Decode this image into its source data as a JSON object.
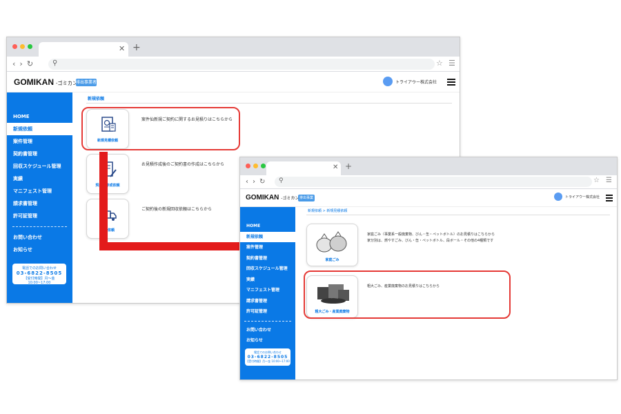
{
  "browser": {
    "url_icon": "search-icon"
  },
  "app": {
    "logo": "GOMIKAN",
    "logo_sub": "-ゴミカン-",
    "badge": "排出事業者",
    "company": "トライアウー株式会社"
  },
  "sidebar": {
    "items": [
      "HOME",
      "新規依頼",
      "案件管理",
      "契約書管理",
      "回収スケジュール管理",
      "実績",
      "マニフェスト管理",
      "請求書管理",
      "許可証管理"
    ],
    "items2": [
      "お問い合わせ",
      "お知らせ"
    ],
    "phone_title": "電話でのお問い合わせ",
    "phone_number": "03-6822-8505",
    "phone_hours": "【受付時間】月～金 10:00~17:00"
  },
  "back_window": {
    "page_title": "新規依頼",
    "cards": [
      {
        "label": "新規見積依頼",
        "desc": "案件仙新規ご契約に関するお見積りはこちらから"
      },
      {
        "label": "契約書作成依頼",
        "desc": "お見積作成後のご契約書の作成はこちらから"
      },
      {
        "label": "回収依頼",
        "desc": "ご契約後の新規回収依頼はこちらから"
      }
    ]
  },
  "front_window": {
    "breadcrumb": "新規依頼 > 新規見積依頼",
    "cards": [
      {
        "label": "家庭ごみ",
        "desc_line1": "家庭ごみ（事業系一般廃棄物、びん・缶・ペットボトル）のお見積りはこちらから",
        "desc_line2": "家分別は、燃やすごみ、びん・缶・ペットボトル、段ボール・その他の4種類です"
      },
      {
        "label": "粗大ごみ・産業廃棄物",
        "desc_line1": "粗大ごみ、産業廃棄物のお見積りはこちらから"
      }
    ]
  },
  "colors": {
    "sidebar": "#0a79e6",
    "highlight": "#e53935",
    "arrow": "#e31b1b"
  }
}
